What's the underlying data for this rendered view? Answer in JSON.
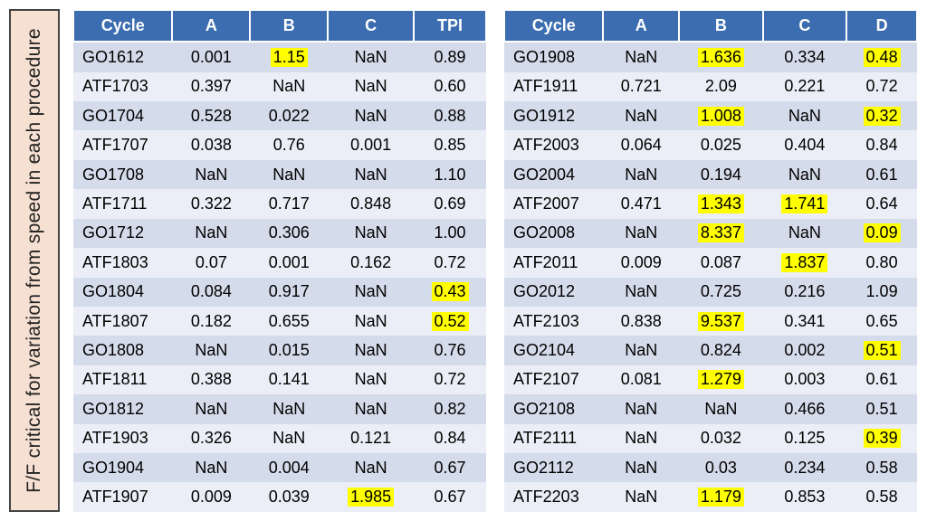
{
  "side_label": "F/F critical for variation from speed in each procedure",
  "left": {
    "headers": [
      "Cycle",
      "A",
      "B",
      "C",
      "TPI"
    ],
    "rows": [
      {
        "c": "GO1612",
        "a": "0.001",
        "b": "1.15",
        "cc": "NaN",
        "d": "0.89",
        "hl": {
          "b": true
        }
      },
      {
        "c": "ATF1703",
        "a": "0.397",
        "b": "NaN",
        "cc": "NaN",
        "d": "0.60"
      },
      {
        "c": "GO1704",
        "a": "0.528",
        "b": "0.022",
        "cc": "NaN",
        "d": "0.88"
      },
      {
        "c": "ATF1707",
        "a": "0.038",
        "b": "0.76",
        "cc": "0.001",
        "d": "0.85"
      },
      {
        "c": "GO1708",
        "a": "NaN",
        "b": "NaN",
        "cc": "NaN",
        "d": "1.10"
      },
      {
        "c": "ATF1711",
        "a": "0.322",
        "b": "0.717",
        "cc": "0.848",
        "d": "0.69"
      },
      {
        "c": "GO1712",
        "a": "NaN",
        "b": "0.306",
        "cc": "NaN",
        "d": "1.00"
      },
      {
        "c": "ATF1803",
        "a": "0.07",
        "b": "0.001",
        "cc": "0.162",
        "d": "0.72"
      },
      {
        "c": "GO1804",
        "a": "0.084",
        "b": "0.917",
        "cc": "NaN",
        "d": "0.43",
        "hl": {
          "d": true
        }
      },
      {
        "c": "ATF1807",
        "a": "0.182",
        "b": "0.655",
        "cc": "NaN",
        "d": "0.52",
        "hl": {
          "d": true
        }
      },
      {
        "c": "GO1808",
        "a": "NaN",
        "b": "0.015",
        "cc": "NaN",
        "d": "0.76"
      },
      {
        "c": "ATF1811",
        "a": "0.388",
        "b": "0.141",
        "cc": "NaN",
        "d": "0.72"
      },
      {
        "c": "GO1812",
        "a": "NaN",
        "b": "NaN",
        "cc": "NaN",
        "d": "0.82"
      },
      {
        "c": "ATF1903",
        "a": "0.326",
        "b": "NaN",
        "cc": "0.121",
        "d": "0.84"
      },
      {
        "c": "GO1904",
        "a": "NaN",
        "b": "0.004",
        "cc": "NaN",
        "d": "0.67"
      },
      {
        "c": "ATF1907",
        "a": "0.009",
        "b": "0.039",
        "cc": "1.985",
        "d": "0.67",
        "hl": {
          "cc": true
        }
      }
    ]
  },
  "right": {
    "headers": [
      "Cycle",
      "A",
      "B",
      "C",
      "D"
    ],
    "rows": [
      {
        "c": "GO1908",
        "a": "NaN",
        "b": "1.636",
        "cc": "0.334",
        "d": "0.48",
        "hl": {
          "b": true,
          "d": true
        }
      },
      {
        "c": "ATF1911",
        "a": "0.721",
        "b": "2.09",
        "cc": "0.221",
        "d": "0.72"
      },
      {
        "c": "GO1912",
        "a": "NaN",
        "b": "1.008",
        "cc": "NaN",
        "d": "0.32",
        "hl": {
          "b": true,
          "d": true
        }
      },
      {
        "c": "ATF2003",
        "a": "0.064",
        "b": "0.025",
        "cc": "0.404",
        "d": "0.84"
      },
      {
        "c": "GO2004",
        "a": "NaN",
        "b": "0.194",
        "cc": "NaN",
        "d": "0.61"
      },
      {
        "c": "ATF2007",
        "a": "0.471",
        "b": "1.343",
        "cc": "1.741",
        "d": "0.64",
        "hl": {
          "b": true,
          "cc": true
        }
      },
      {
        "c": "GO2008",
        "a": "NaN",
        "b": "8.337",
        "cc": "NaN",
        "d": "0.09",
        "hl": {
          "b": true,
          "d": true
        }
      },
      {
        "c": "ATF2011",
        "a": "0.009",
        "b": "0.087",
        "cc": "1.837",
        "d": "0.80",
        "hl": {
          "cc": true
        }
      },
      {
        "c": "GO2012",
        "a": "NaN",
        "b": "0.725",
        "cc": "0.216",
        "d": "1.09"
      },
      {
        "c": "ATF2103",
        "a": "0.838",
        "b": "9.537",
        "cc": "0.341",
        "d": "0.65",
        "hl": {
          "b": true
        }
      },
      {
        "c": "GO2104",
        "a": "NaN",
        "b": "0.824",
        "cc": "0.002",
        "d": "0.51",
        "hl": {
          "d": true
        }
      },
      {
        "c": "ATF2107",
        "a": "0.081",
        "b": "1.279",
        "cc": "0.003",
        "d": "0.61",
        "hl": {
          "b": true
        }
      },
      {
        "c": "GO2108",
        "a": "NaN",
        "b": "NaN",
        "cc": "0.466",
        "d": "0.51"
      },
      {
        "c": "ATF2111",
        "a": "NaN",
        "b": "0.032",
        "cc": "0.125",
        "d": "0.39",
        "hl": {
          "d": true
        }
      },
      {
        "c": "GO2112",
        "a": "NaN",
        "b": "0.03",
        "cc": "0.234",
        "d": "0.58"
      },
      {
        "c": "ATF2203",
        "a": "NaN",
        "b": "1.179",
        "cc": "0.853",
        "d": "0.58",
        "hl": {
          "b": true
        }
      }
    ]
  }
}
